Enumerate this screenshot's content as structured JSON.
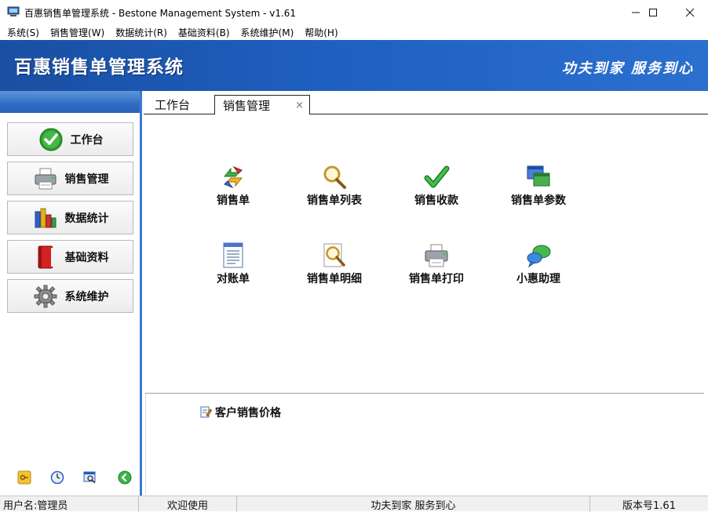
{
  "window": {
    "title": "百惠销售单管理系统 - Bestone Management System - v1.61",
    "controls": {
      "minimize": "—",
      "maximize": "☐",
      "close": "✕"
    }
  },
  "menu": {
    "items": [
      {
        "label": "系统(S)"
      },
      {
        "label": "销售管理(W)"
      },
      {
        "label": "数据统计(R)"
      },
      {
        "label": "基础资料(B)"
      },
      {
        "label": "系统维护(M)"
      },
      {
        "label": "帮助(H)"
      }
    ]
  },
  "banner": {
    "app_name": "百惠销售单管理系统",
    "slogan": "功夫到家 服务到心",
    "colors": {
      "start": "#1a4fa3",
      "end": "#2c70cf"
    }
  },
  "sidebar": {
    "items": [
      {
        "label": "工作台",
        "icon": "green-check-icon"
      },
      {
        "label": "销售管理",
        "icon": "printer-icon"
      },
      {
        "label": "数据统计",
        "icon": "bar-chart-icon"
      },
      {
        "label": "基础资料",
        "icon": "red-book-icon"
      },
      {
        "label": "系统维护",
        "icon": "gear-icon"
      }
    ],
    "bottom_icons": [
      "key-icon",
      "clock-icon",
      "search-window-icon",
      "back-arrow-icon"
    ]
  },
  "tabs": {
    "items": [
      {
        "label": "工作台",
        "active": false
      },
      {
        "label": "销售管理",
        "active": true,
        "close": "×"
      }
    ]
  },
  "functions": {
    "items": [
      {
        "label": "销售单",
        "icon": "recycle-arrows-icon"
      },
      {
        "label": "销售单列表",
        "icon": "magnifier-icon"
      },
      {
        "label": "销售收款",
        "icon": "green-check-icon"
      },
      {
        "label": "销售单参数",
        "icon": "windows-icon"
      },
      {
        "label": "对账单",
        "icon": "document-list-icon"
      },
      {
        "label": "销售单明细",
        "icon": "magnifier-document-icon"
      },
      {
        "label": "销售单打印",
        "icon": "printer-icon"
      },
      {
        "label": "小惠助理",
        "icon": "chat-bubbles-icon"
      }
    ]
  },
  "quick_links": {
    "items": [
      {
        "label": "客户销售价格",
        "icon": "edit-document-icon"
      }
    ]
  },
  "status": {
    "user": "用户名:管理员",
    "welcome": "欢迎使用",
    "slogan": "功夫到家 服务到心",
    "version": "版本号1.61"
  }
}
